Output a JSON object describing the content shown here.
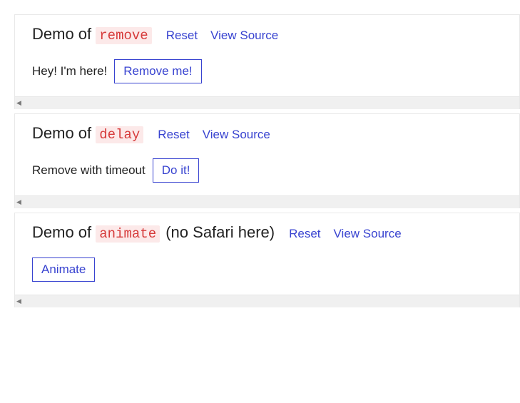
{
  "demos": [
    {
      "title_prefix": "Demo of",
      "code": "remove",
      "note": "",
      "reset": "Reset",
      "view_source": "View Source",
      "body_text": "Hey! I'm here!",
      "button": "Remove me!"
    },
    {
      "title_prefix": "Demo of",
      "code": "delay",
      "note": "",
      "reset": "Reset",
      "view_source": "View Source",
      "body_text": "Remove with timeout",
      "button": "Do it!"
    },
    {
      "title_prefix": "Demo of",
      "code": "animate",
      "note": "(no Safari here)",
      "reset": "Reset",
      "view_source": "View Source",
      "body_text": "",
      "button": "Animate"
    }
  ]
}
